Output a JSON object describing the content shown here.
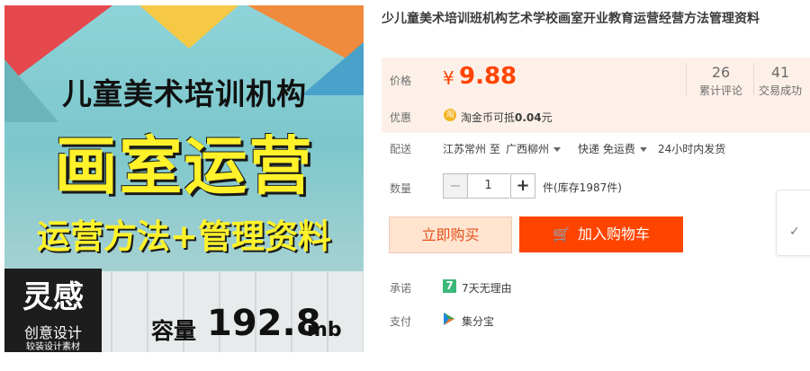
{
  "product_image": {
    "headline1": "儿童美术培训机构",
    "headline2": "画室运营",
    "headline3": "运营方法+管理资料",
    "brand_logo": "灵感",
    "brand_line": "创意设计",
    "brand_sub": "较装设计素材",
    "size_label": "容量",
    "size_value": "192.8",
    "size_unit": "mb"
  },
  "product": {
    "title": "少儿童美术培训班机构艺术学校画室开业教育运营经营方法管理资料"
  },
  "price": {
    "label": "价格",
    "currency": "¥",
    "value": "9.88",
    "reviews_count": "26",
    "reviews_label": "累计评论",
    "sales_count": "41",
    "sales_label": "交易成功"
  },
  "promo": {
    "label": "优惠",
    "coin_icon": "淘",
    "text_prefix": "淘金币可抵",
    "amount": "0.04",
    "text_suffix": "元"
  },
  "shipping": {
    "label": "配送",
    "from": "江苏常州 至",
    "to": "广西柳州",
    "method": "快递 免运费",
    "time": "24小时内发货"
  },
  "quantity": {
    "label": "数量",
    "minus": "−",
    "value": "1",
    "plus": "+",
    "stock": "件(库存1987件)"
  },
  "actions": {
    "buy_now": "立即购买",
    "add_cart": "加入购物车",
    "cart_icon": "🛒"
  },
  "promise": {
    "label": "承诺",
    "icon": "7",
    "text": "7天无理由"
  },
  "payment": {
    "label": "支付",
    "text": "集分宝"
  },
  "side": {
    "check": "✓"
  },
  "colors": {
    "accent": "#ff4400",
    "price": "#ff4400",
    "price_panel_bg": "#fdf0e8",
    "promise_icon": "#3cb878"
  }
}
